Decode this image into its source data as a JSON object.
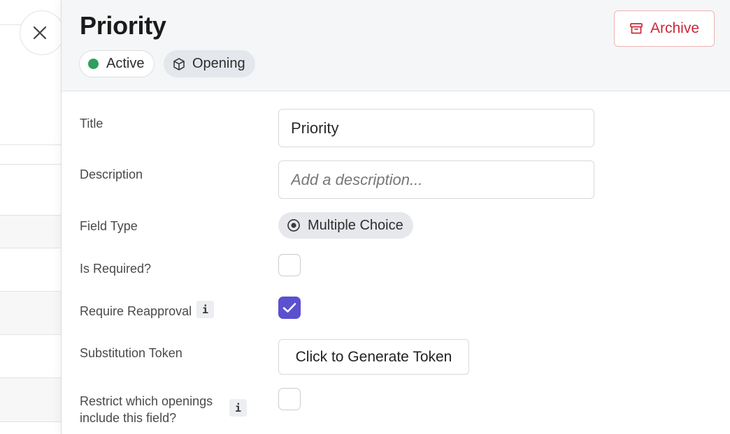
{
  "header": {
    "title": "Priority",
    "status_label": "Active",
    "status_color": "#2f9e5f",
    "scope_label": "Opening",
    "scope_icon": "cube-icon",
    "archive_label": "Archive",
    "archive_icon": "archive-box-icon",
    "close_icon": "close-icon"
  },
  "form": {
    "title_label": "Title",
    "title_value": "Priority",
    "description_label": "Description",
    "description_placeholder": "Add a description...",
    "field_type_label": "Field Type",
    "field_type_value": "Multiple Choice",
    "field_type_icon": "radio-button-icon",
    "is_required_label": "Is Required?",
    "is_required_checked": false,
    "require_reapproval_label": "Require Reapproval",
    "require_reapproval_checked": true,
    "info_glyph": "i",
    "substitution_token_label": "Substitution Token",
    "generate_token_label": "Click to Generate Token",
    "restrict_openings_label_line1": "Restrict which openings",
    "restrict_openings_label_line2": "include this field?",
    "restrict_openings_checked": false
  },
  "colors": {
    "accent": "#5b50cf",
    "danger": "#c8283a",
    "success": "#2f9e5f"
  }
}
